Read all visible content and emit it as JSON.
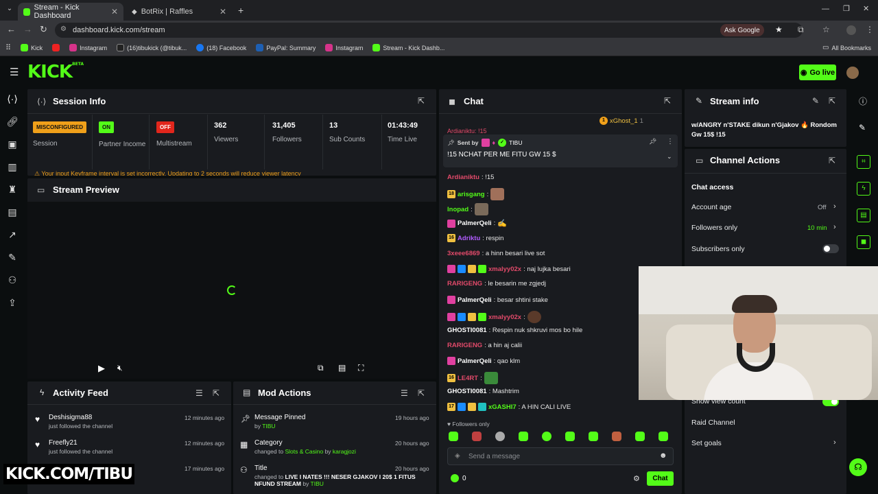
{
  "browser": {
    "tabs": [
      {
        "title": "Stream - Kick Dashboard"
      },
      {
        "title": "BotRix | Raffles"
      }
    ],
    "url": "dashboard.kick.com/stream",
    "ask_google": "Ask Google",
    "bookmarks": [
      "Kick",
      "Instagram",
      "(16)tibukick (@tibuk...",
      "(18) Facebook",
      "PayPal: Summary",
      "Instagram",
      "Stream - Kick Dashb..."
    ],
    "all_bookmarks": "All Bookmarks"
  },
  "header": {
    "logo": "KICK",
    "beta": "BETA",
    "go_live": "Go live"
  },
  "session": {
    "title": "Session Info",
    "stats": [
      {
        "badge": "MISCONFIGURED",
        "label": "Session"
      },
      {
        "badge": "ON",
        "label": "Partner Income"
      },
      {
        "badge": "OFF",
        "label": "Multistream"
      },
      {
        "value": "362",
        "label": "Viewers"
      },
      {
        "value": "31,405",
        "label": "Followers"
      },
      {
        "value": "13",
        "label": "Sub Counts"
      },
      {
        "value": "01:43:49",
        "label": "Time Live"
      }
    ],
    "warning": "Your input Keyframe interval is set incorrectly. Updating to 2 seconds will reduce viewer latency"
  },
  "preview": {
    "title": "Stream Preview"
  },
  "activity": {
    "title": "Activity Feed",
    "items": [
      {
        "user": "Deshisigma88",
        "sub": "just followed the channel",
        "time": "12 minutes ago"
      },
      {
        "user": "Freefly21",
        "sub": "just followed the channel",
        "time": "12 minutes ago"
      },
      {
        "user": "",
        "sub": "",
        "time": "17 minutes ago"
      }
    ]
  },
  "mod": {
    "title": "Mod Actions",
    "items": [
      {
        "title": "Message Pinned",
        "sub1": "by",
        "sub2": "TIBU",
        "sub3": "",
        "time": "19 hours ago"
      },
      {
        "title": "Category",
        "sub1": "changed to",
        "sub2": "Slots & Casino",
        "sub3": "karagjozi",
        "time": "20 hours ago"
      },
      {
        "title": "Title",
        "sub1": "changed to",
        "sub2": "LIVE I NATES !!! NESER GJAKOV I 20$ 1 FITUS NFUND STREAM",
        "sub3": "TIBU",
        "time": "20 hours ago"
      }
    ]
  },
  "chat": {
    "title": "Chat",
    "top_user": "xGhost_1",
    "top_count": "1",
    "partial": "Ardianiktu: !15",
    "pinned_by_label": "Sent by",
    "pinned_by_user": "TIBU",
    "pinned_msg": "!15 NCHAT PER ME FITU GW 15 $",
    "messages": [
      {
        "user": "Ardianiktu",
        "text": ": !15",
        "color": "#e24a6a"
      },
      {
        "user": "arisgang",
        "text": ":",
        "color": "#53fc18"
      },
      {
        "user": "lnopad",
        "text": ":",
        "color": "#53fc18"
      },
      {
        "user": "PalmerQeli",
        "text": ":",
        "color": "#ffffff"
      },
      {
        "user": "Adriktu",
        "text": ": respin",
        "color": "#b15cff"
      },
      {
        "user": "3xeee6869",
        "text": ": a hinn besari live sot",
        "color": "#e24a6a"
      },
      {
        "user": "xmalyy02x",
        "text": ": naj lujka besari",
        "color": "#e24a6a"
      },
      {
        "user": "RARIGENG",
        "text": ": le besarin me zgjedj",
        "color": "#e24a6a"
      },
      {
        "user": "PalmerQeli",
        "text": ": besar shtini stake",
        "color": "#ffffff"
      },
      {
        "user": "xmalyy02x",
        "text": ":",
        "color": "#e24a6a"
      },
      {
        "user": "GHOSTI0081",
        "text": ": Respin nuk shkruvi mos bo hile",
        "color": "#ffffff"
      },
      {
        "user": "RARIGENG",
        "text": ": a hin aj calii",
        "color": "#e24a6a"
      },
      {
        "user": "PalmerQeli",
        "text": ": qao klm",
        "color": "#ffffff"
      },
      {
        "user": "LE4RT",
        "text": ":",
        "color": "#e24a6a"
      },
      {
        "user": "GHOSTI0081",
        "text": ": Mashtrim",
        "color": "#ffffff"
      },
      {
        "user": "xGASHI7",
        "text": ": A HIN CALI LIVE",
        "color": "#53fc18"
      }
    ],
    "followers_only": "Followers only",
    "placeholder": "Send a message",
    "count": "0",
    "send": "Chat"
  },
  "stream_info": {
    "title": "Stream info",
    "text": "w/ANGRY n'STAKE dikun n'Gjakov 🔥 Rondom Gw 15$ !15"
  },
  "channel_actions": {
    "title": "Channel Actions",
    "section": "Chat access",
    "rows": [
      {
        "label": "Account age",
        "value": "Off"
      },
      {
        "label": "Followers only",
        "value": "10 min"
      },
      {
        "label": "Subscribers only",
        "value": ""
      }
    ],
    "lower": [
      "Show view count",
      "Raid Channel",
      "Set goals"
    ]
  },
  "overlay_text": "KICK.COM/TIBU",
  "colors": {
    "accent": "#53fc18",
    "panel": "#191b1f",
    "bg": "#0b0e0f"
  }
}
